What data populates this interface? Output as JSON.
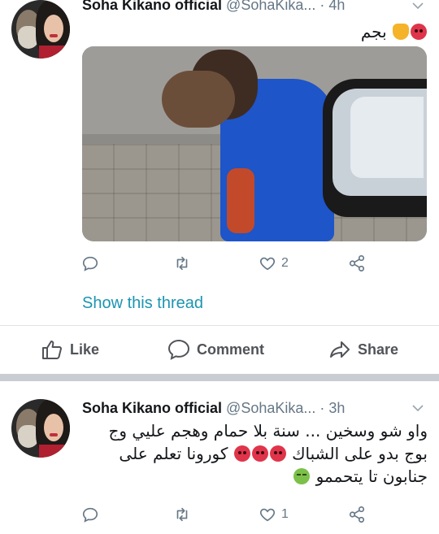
{
  "tweets": [
    {
      "name": "Soha Kikano official",
      "handle": "@SohaKika...",
      "dot": "·",
      "time": "4h",
      "text_line1": "بجم",
      "reply_count": "",
      "retweet_count": "",
      "like_count": "2",
      "show_thread": "Show this thread"
    },
    {
      "name": "Soha Kikano official",
      "handle": "@SohaKika...",
      "dot": "·",
      "time": "3h",
      "text_line1": "واو شو وسخين ... سنة بلا حمام وهجم عليي وج",
      "text_line2a": "بوج بدو على الشباك",
      "text_line2b": "كورونا تعلم على",
      "text_line3": "جنابون تا يتحممو",
      "reply_count": "",
      "retweet_count": "",
      "like_count": "1"
    }
  ],
  "facebook_bar": {
    "like_label": "Like",
    "comment_label": "Comment",
    "share_label": "Share"
  },
  "icons": {
    "reply": "reply-icon",
    "retweet": "retweet-icon",
    "like": "heart-icon",
    "share": "share-icon",
    "chevron": "chevron-down-icon"
  },
  "colors": {
    "link": "#1b95b0",
    "muted": "#657786",
    "separator": "#c9ccd1"
  }
}
